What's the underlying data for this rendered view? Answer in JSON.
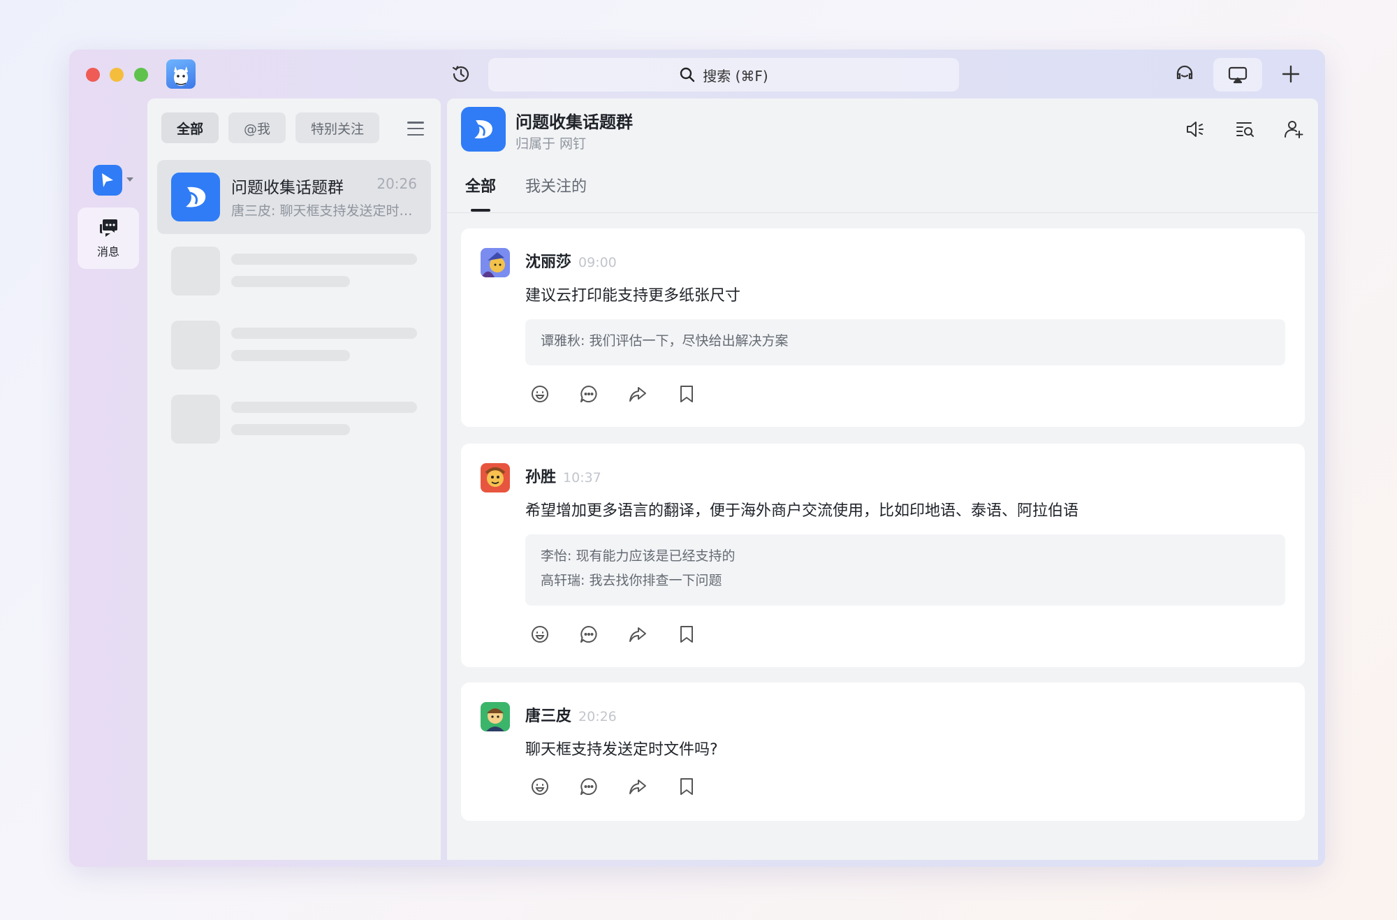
{
  "titlebar": {
    "search_label": "搜索 (⌘F)"
  },
  "rail": {
    "messages_label": "消息"
  },
  "conversation_list": {
    "filters": [
      {
        "label": "全部",
        "active": true
      },
      {
        "label": "@我",
        "active": false
      },
      {
        "label": "特别关注",
        "active": false
      }
    ],
    "items": [
      {
        "name": "问题收集话题群",
        "time": "20:26",
        "preview": "唐三皮: 聊天框支持发送定时文件吗?"
      }
    ]
  },
  "chat": {
    "title": "问题收集话题群",
    "subtitle": "归属于 网钉",
    "tabs": [
      {
        "label": "全部",
        "active": true
      },
      {
        "label": "我关注的",
        "active": false
      }
    ],
    "messages": [
      {
        "author": "沈丽莎",
        "time": "09:00",
        "text": "建议云打印能支持更多纸张尺寸",
        "avatar_color": "#7a8cf0",
        "replies": [
          "谭雅秋: 我们评估一下，尽快给出解决方案"
        ]
      },
      {
        "author": "孙胜",
        "time": "10:37",
        "text": "希望增加更多语言的翻译，便于海外商户交流使用，比如印地语、泰语、阿拉伯语",
        "avatar_color": "#e8553f",
        "replies": [
          "李怡: 现有能力应该是已经支持的",
          "高轩瑞: 我去找你排查一下问题"
        ]
      },
      {
        "author": "唐三皮",
        "time": "20:26",
        "text": "聊天框支持发送定时文件吗?",
        "avatar_color": "#3bb56a",
        "replies": []
      }
    ]
  },
  "colors": {
    "accent": "#2f7cf6",
    "text_primary": "#1f2329",
    "text_secondary": "#8f959e"
  },
  "icons": [
    "history-icon",
    "search-icon",
    "headset-icon",
    "screen-share-icon",
    "plus-icon",
    "speaker-icon",
    "search-messages-icon",
    "add-member-icon",
    "more-icon",
    "emoji-icon",
    "comment-icon",
    "share-icon",
    "bookmark-icon"
  ]
}
